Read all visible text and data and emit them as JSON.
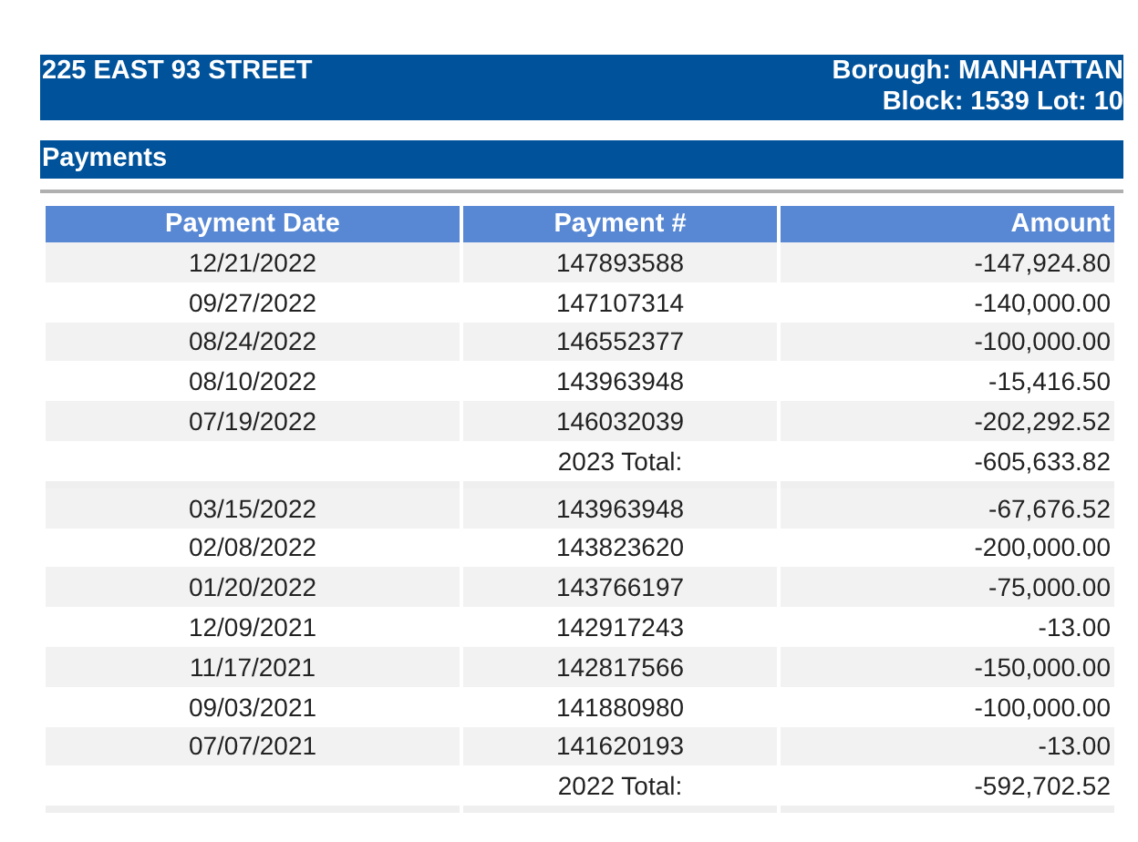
{
  "property": {
    "address": "225 EAST 93 STREET",
    "borough": "Borough: MANHATTAN",
    "block_lot": "Block: 1539 Lot: 10"
  },
  "section": {
    "title": "Payments"
  },
  "table": {
    "columns": [
      "Payment Date",
      "Payment #",
      "Amount"
    ],
    "groups": [
      {
        "rows": [
          {
            "date": "12/21/2022",
            "number": "147893588",
            "amount": "-147,924.80"
          },
          {
            "date": "09/27/2022",
            "number": "147107314",
            "amount": "-140,000.00"
          },
          {
            "date": "08/24/2022",
            "number": "146552377",
            "amount": "-100,000.00"
          },
          {
            "date": "08/10/2022",
            "number": "143963948",
            "amount": "-15,416.50"
          },
          {
            "date": "07/19/2022",
            "number": "146032039",
            "amount": "-202,292.52"
          }
        ],
        "total_label": "2023 Total:",
        "total": "-605,633.82"
      },
      {
        "rows": [
          {
            "date": "03/15/2022",
            "number": "143963948",
            "amount": "-67,676.52"
          },
          {
            "date": "02/08/2022",
            "number": "143823620",
            "amount": "-200,000.00"
          },
          {
            "date": "01/20/2022",
            "number": "143766197",
            "amount": "-75,000.00"
          },
          {
            "date": "12/09/2021",
            "number": "142917243",
            "amount": "-13.00"
          },
          {
            "date": "11/17/2021",
            "number": "142817566",
            "amount": "-150,000.00"
          },
          {
            "date": "09/03/2021",
            "number": "141880980",
            "amount": "-100,000.00"
          },
          {
            "date": "07/07/2021",
            "number": "141620193",
            "amount": "-13.00"
          }
        ],
        "total_label": "2022 Total:",
        "total": "-592,702.52"
      }
    ]
  }
}
